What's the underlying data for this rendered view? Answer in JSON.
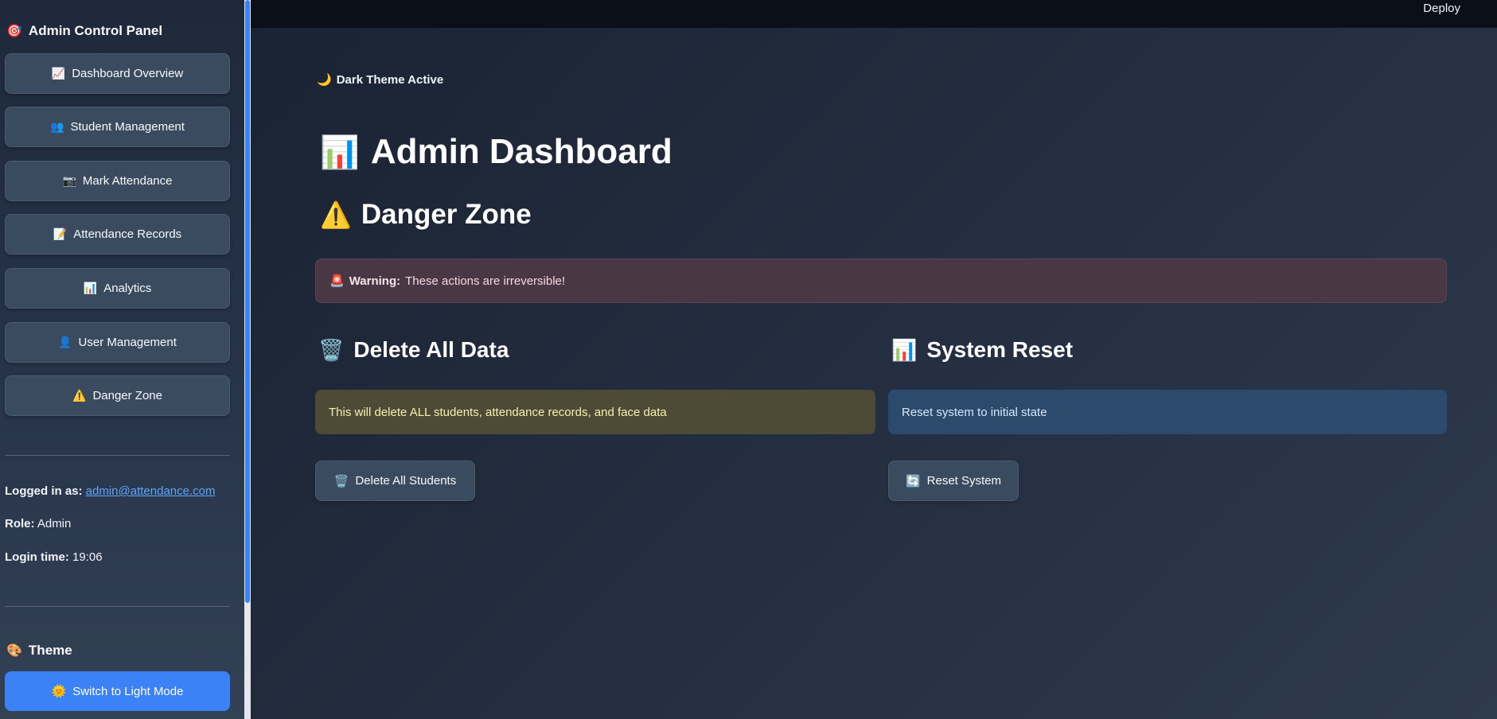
{
  "sidebar": {
    "title": {
      "icon": "🎯",
      "label": "Admin Control Panel"
    },
    "nav": [
      {
        "icon": "📈",
        "label": "Dashboard Overview"
      },
      {
        "icon": "👥",
        "label": "Student Management"
      },
      {
        "icon": "📷",
        "label": "Mark Attendance"
      },
      {
        "icon": "📝",
        "label": "Attendance Records"
      },
      {
        "icon": "📊",
        "label": "Analytics"
      },
      {
        "icon": "👤",
        "label": "User Management"
      },
      {
        "icon": "⚠️",
        "label": "Danger Zone"
      }
    ],
    "session": {
      "logged_in_label": "Logged in as:",
      "email": "admin@attendance.com",
      "role_label": "Role:",
      "role": "Admin",
      "login_time_label": "Login time:",
      "login_time": "19:06"
    },
    "theme": {
      "icon": "🎨",
      "heading": "Theme",
      "button_icon": "🌞",
      "button_label": "Switch to Light Mode"
    }
  },
  "topbar": {
    "deploy_label": "Deploy"
  },
  "main": {
    "theme_status": {
      "icon": "🌙",
      "label": "Dark Theme Active"
    },
    "title": {
      "icon": "📊",
      "label": "Admin Dashboard"
    },
    "section": {
      "icon": "⚠️",
      "label": "Danger Zone"
    },
    "warning": {
      "icon": "🚨",
      "strong": "Warning:",
      "text": "These actions are irreversible!"
    },
    "delete_col": {
      "icon": "🗑️",
      "heading": "Delete All Data",
      "notice": "This will delete ALL students, attendance records, and face data",
      "button_icon": "🗑️",
      "button_label": "Delete All Students"
    },
    "reset_col": {
      "icon": "📊",
      "heading": "System Reset",
      "notice": "Reset system to initial state",
      "button_icon": "🔄",
      "button_label": "Reset System"
    }
  },
  "colors": {
    "accent": "#3b82f6",
    "sidebar_bg": "#1e293b",
    "topbar_bg": "#0b0f17",
    "error_bg": "#4a3746",
    "warning_bg": "#4d4b36",
    "info_bg": "#2c4a6c"
  }
}
